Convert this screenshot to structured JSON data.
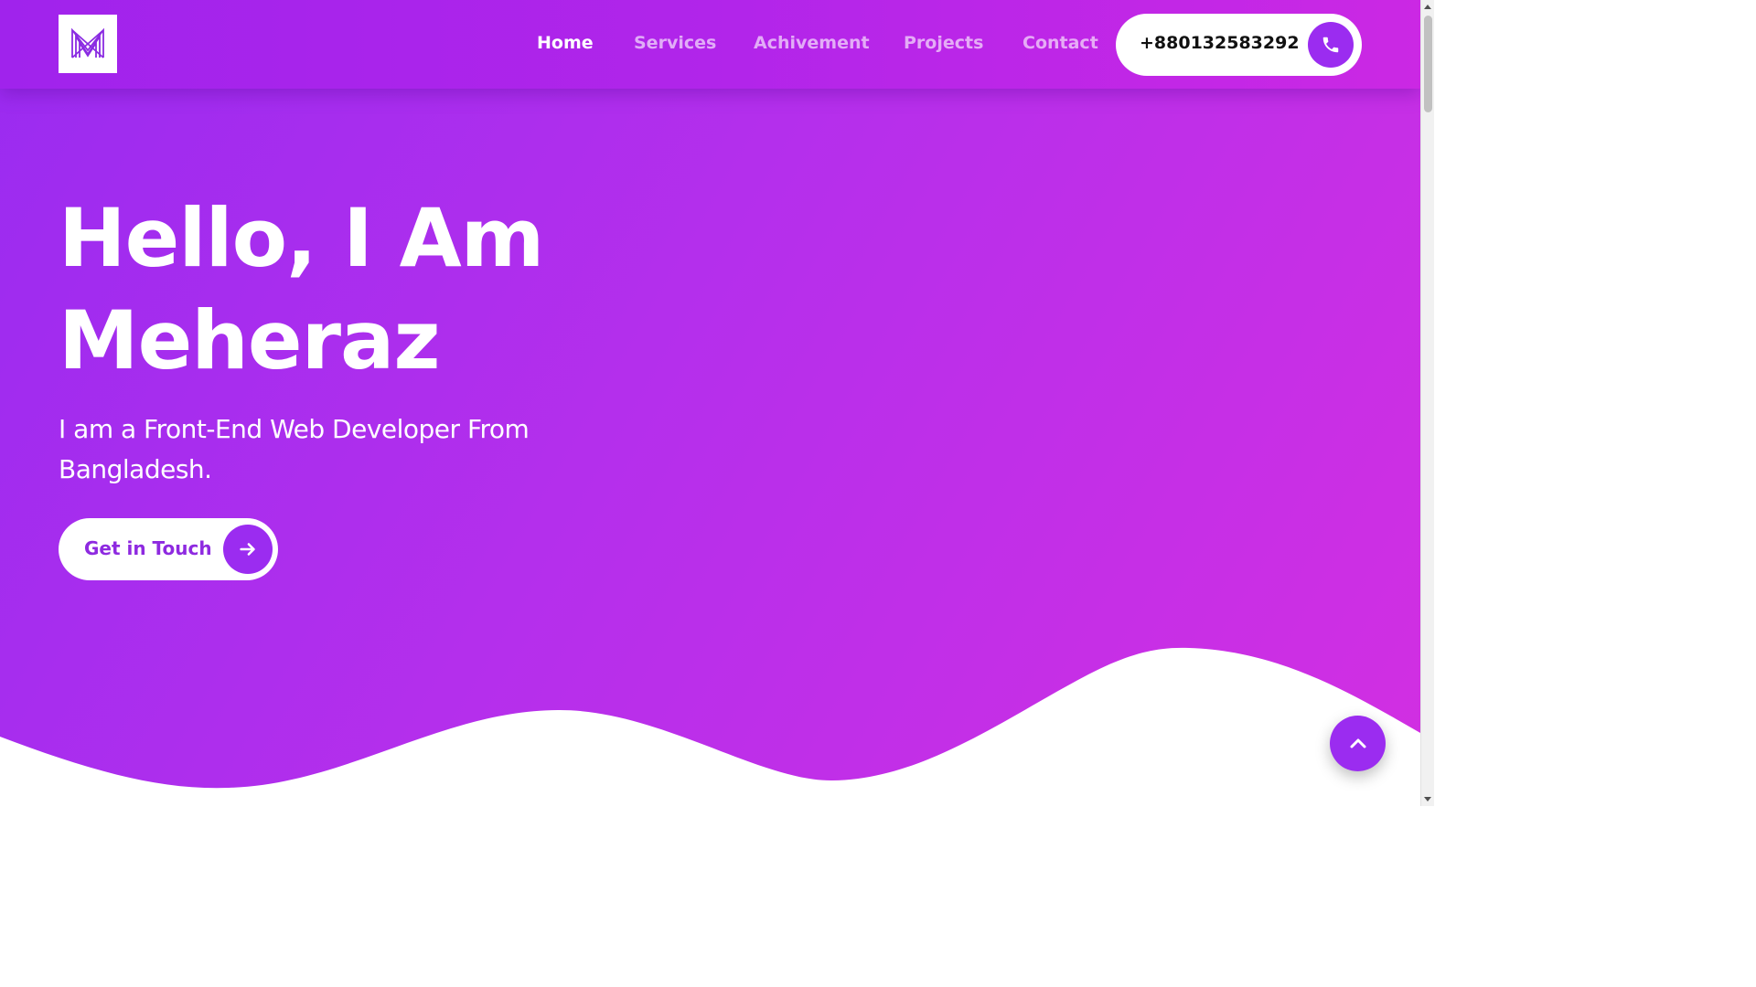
{
  "navbar": {
    "logo_icon": "monogram-m-logo",
    "links": [
      {
        "label": "Home",
        "active": true
      },
      {
        "label": "Services",
        "active": false
      },
      {
        "label": "Achivement",
        "active": false
      },
      {
        "label": "Projects",
        "active": false
      },
      {
        "label": "Contact",
        "active": false
      }
    ],
    "phone": {
      "number": "+880132583292",
      "icon": "phone-icon"
    }
  },
  "hero": {
    "title_line1": "Hello, I Am",
    "title_line2": "Meheraz",
    "subtitle": "I am a Front-End Web Developer From Bangladesh.",
    "cta": {
      "label": "Get in Touch",
      "icon": "arrow-right-icon"
    }
  },
  "scroll_top": {
    "icon": "chevron-up-icon"
  },
  "colors": {
    "accent": "#9b2cf0",
    "gradient_start": "#9a2bf0",
    "gradient_end": "#d22fe2",
    "cta_text": "#8e2ae0"
  }
}
